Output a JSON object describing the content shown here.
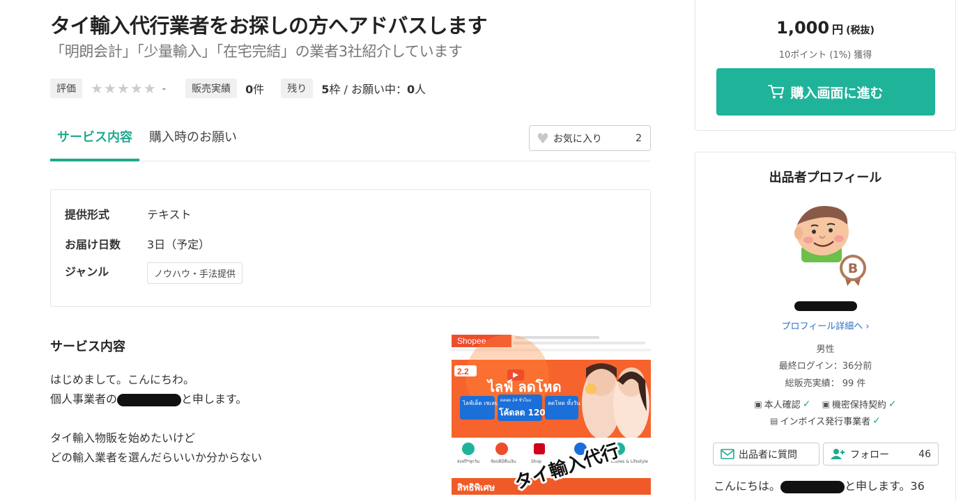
{
  "service": {
    "title": "タイ輸入代行業者をお探しの方へアドバスします",
    "subtitle": "「明朗会計」「少量輸入」「在宅完結」の業者3社紹介しています"
  },
  "stats": {
    "rating_label": "評価",
    "rating_value": "-",
    "sales_label": "販売実績",
    "sales_count": "0",
    "sales_unit": "件",
    "remaining_label": "残り",
    "remaining_count": "5",
    "remaining_unit": "枠 / お願い中：",
    "requesting_count": "0",
    "requesting_unit": "人"
  },
  "tabs": [
    {
      "label": "サービス内容",
      "active": true
    },
    {
      "label": "購入時のお願い",
      "active": false
    }
  ],
  "favorite": {
    "label": "お気に入り",
    "count": "2"
  },
  "specs": [
    {
      "key": "提供形式",
      "value": "テキスト"
    },
    {
      "key": "お届け日数",
      "value": "3日（予定）"
    },
    {
      "key": "ジャンル",
      "value": "ノウハウ・手法提供"
    }
  ],
  "content": {
    "heading": "サービス内容",
    "line1": "はじめまして。こんにちわ。",
    "line2_pre": "個人事業者の",
    "line2_post": "と申します。",
    "line3": "タイ輸入物販を始めたいけど",
    "line4": "どの輸入業者を選んだらいいか分からない"
  },
  "hero": {
    "brand": "Shopee",
    "promo": "2.2",
    "headline": "ไลฟ์ ลดโหด",
    "tile1": "ไลฟ์เด็ด เซเลบดัง",
    "tile2_top": "ตลอด 24 ชั่วโมง",
    "tile2_main": "โค้ดลด 120.",
    "tile3": "ลดโหด ทั้งวัน",
    "overlay_text": "タイ輸入代行",
    "cat1": "ส่งฟรี*ทุกวัน",
    "cat2": "ช้อปดีมีคืนเงิน",
    "cat3": "Shop",
    "cat4": "Hobbies & Lifestyle",
    "banner_bottom": "สิทธิพิเศษ"
  },
  "purchase": {
    "price": "1,000",
    "currency": "円",
    "tax_note": "(税抜)",
    "points": "10ポイント (1%) 獲得",
    "buy_label": "購入画面に進む"
  },
  "profile": {
    "title": "出品者プロフィール",
    "rank_badge": "B",
    "link_label": "プロフィール詳細へ",
    "gender": "男性",
    "last_login": "最終ログイン：36分前",
    "total_sales": "総販売実績： 99 件",
    "badge_identity": "本人確認",
    "badge_nda": "機密保持契約",
    "badge_invoice": "インボイス発行事業者",
    "ask_label": "出品者に質問",
    "follow_label": "フォロー",
    "follow_count": "46",
    "intro_pre": "こんにちは。",
    "intro_post": "と申します。36"
  },
  "colors": {
    "accent": "#1fa98e",
    "buy_button": "#1fb39a",
    "link": "#2a72c7"
  }
}
